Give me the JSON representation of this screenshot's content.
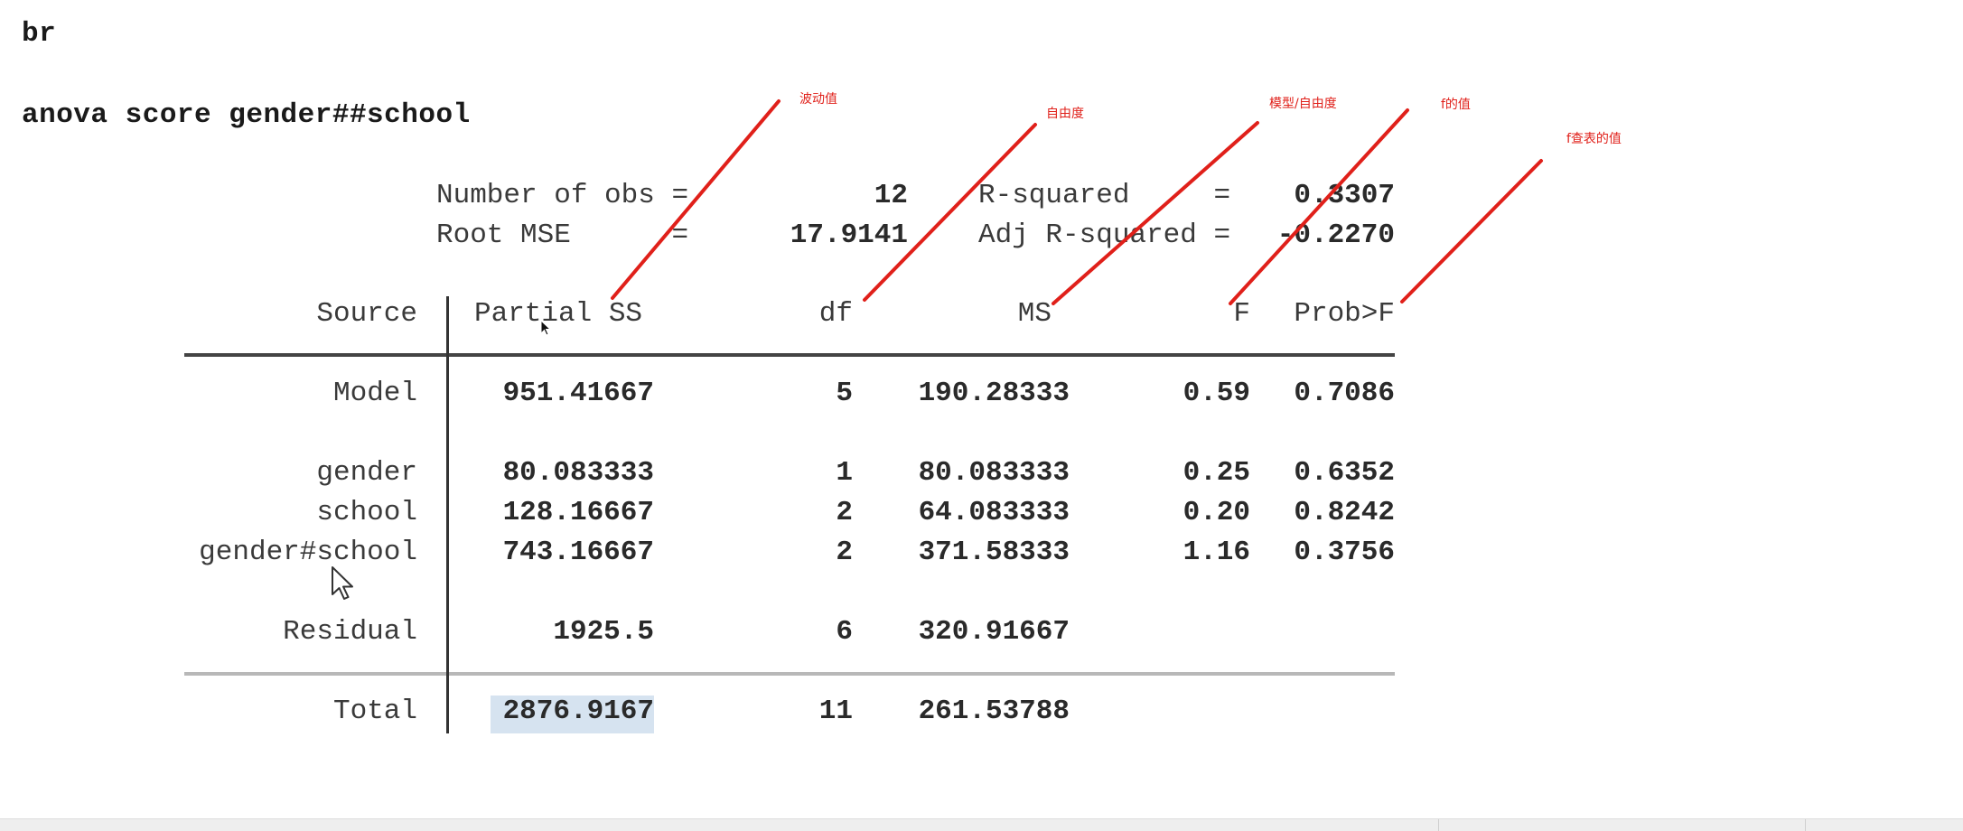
{
  "commands": {
    "line1": "br",
    "line2": "anova score gender##school"
  },
  "summary": {
    "obs_label": "Number of obs =",
    "obs_value": "12",
    "rmse_label": "Root MSE      =",
    "rmse_value": "17.9141",
    "r2_label": "R-squared     =",
    "r2_value": "0.3307",
    "adjr2_label": "Adj R-squared =",
    "adjr2_value": "-0.2270"
  },
  "table": {
    "headers": {
      "source": "Source",
      "partial_ss": "Partial SS",
      "df": "df",
      "ms": "MS",
      "f": "F",
      "prob": "Prob>F"
    },
    "rows": [
      {
        "source": "Model",
        "ss": "951.41667",
        "df": "5",
        "ms": "190.28333",
        "f": "0.59",
        "prob": "0.7086"
      },
      {
        "source": "gender",
        "ss": "80.083333",
        "df": "1",
        "ms": "80.083333",
        "f": "0.25",
        "prob": "0.6352"
      },
      {
        "source": "school",
        "ss": "128.16667",
        "df": "2",
        "ms": "64.083333",
        "f": "0.20",
        "prob": "0.8242"
      },
      {
        "source": "gender#school",
        "ss": "743.16667",
        "df": "2",
        "ms": "371.58333",
        "f": "1.16",
        "prob": "0.3756"
      },
      {
        "source": "Residual",
        "ss": "1925.5",
        "df": "6",
        "ms": "320.91667",
        "f": "",
        "prob": ""
      },
      {
        "source": "Total",
        "ss": "2876.9167",
        "df": "11",
        "ms": "261.53788",
        "f": "",
        "prob": ""
      }
    ]
  },
  "annotations": {
    "ss": "波动值",
    "df": "自由度",
    "ms": "模型/自由度",
    "f": "f的值",
    "prob": "f查表的值",
    "color": "#e0201a"
  },
  "colors": {
    "highlight": "#d6e3f0",
    "text": "#3a3a3a"
  }
}
